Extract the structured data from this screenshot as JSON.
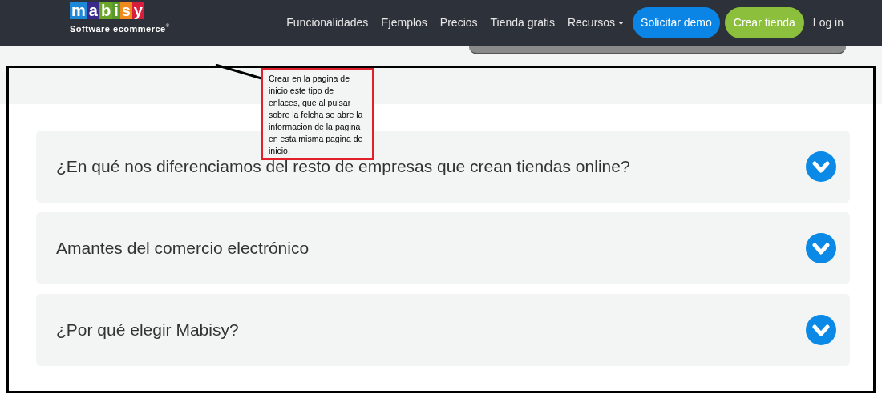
{
  "logo": {
    "letters": [
      {
        "char": "m",
        "color": "#1e88d8"
      },
      {
        "char": "a",
        "color": "#3a2a8c"
      },
      {
        "char": "b",
        "color": "#6aa52a"
      },
      {
        "char": "i",
        "color": "#5a9a2a"
      },
      {
        "char": "s",
        "color": "#f08a1c"
      },
      {
        "char": "y",
        "color": "#d81e3c"
      }
    ],
    "tagline": "Software ecommerce",
    "mark": "®"
  },
  "nav": [
    {
      "label": "Funcionalidades",
      "kind": "link"
    },
    {
      "label": "Ejemplos",
      "kind": "link"
    },
    {
      "label": "Precios",
      "kind": "link"
    },
    {
      "label": "Tienda gratis",
      "kind": "link"
    },
    {
      "label": "Recursos",
      "kind": "dropdown"
    },
    {
      "label": "Solicitar demo",
      "kind": "primary"
    },
    {
      "label": "Crear tienda",
      "kind": "success"
    },
    {
      "label": "Log in",
      "kind": "link"
    }
  ],
  "annotation": {
    "text": "Crear en la pagina de inicio este tipo de enlaces, que al pulsar sobre la felcha se abre la informacion de la pagina en esta misma pagina de inicio."
  },
  "faq": [
    {
      "question": "¿En qué nos diferenciamos del resto de empresas que crean tiendas online?",
      "expanded": false
    },
    {
      "question": "Amantes del comercio electrónico",
      "expanded": false
    },
    {
      "question": "¿Por qué elegir Mabisy?",
      "expanded": false
    }
  ]
}
